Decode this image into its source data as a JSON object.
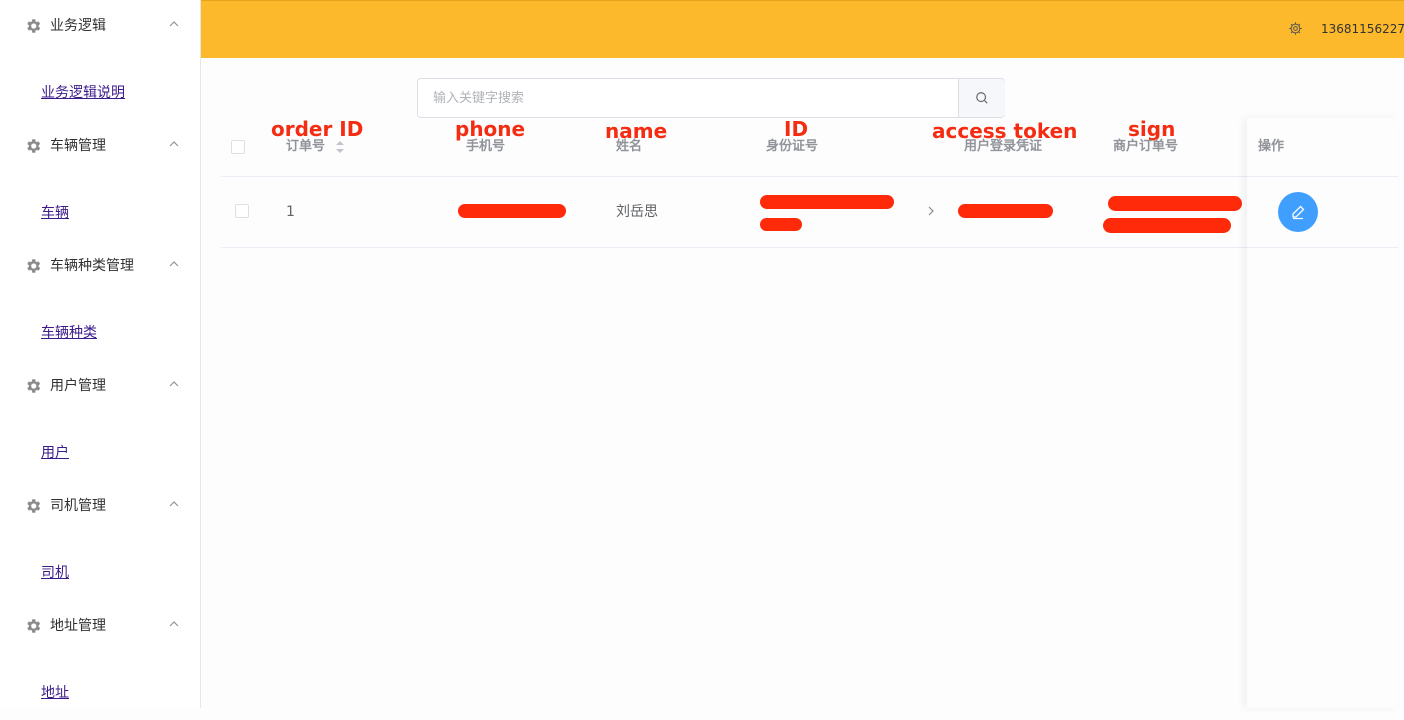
{
  "sidebar": {
    "groups": [
      {
        "title": "业务逻辑",
        "item": "业务逻辑说明"
      },
      {
        "title": "车辆管理",
        "item": "车辆"
      },
      {
        "title": "车辆种类管理",
        "item": "车辆种类"
      },
      {
        "title": "用户管理",
        "item": "用户"
      },
      {
        "title": "司机管理",
        "item": "司机"
      },
      {
        "title": "地址管理",
        "item": "地址"
      }
    ]
  },
  "header": {
    "user": "13681156227",
    "bg_color": "#fbb92b"
  },
  "search": {
    "placeholder": "输入关键字搜索"
  },
  "table": {
    "annotations": [
      "order ID",
      "phone",
      "name",
      "ID",
      "access token",
      "sign"
    ],
    "columns": [
      "订单号",
      "手机号",
      "姓名",
      "身份证号",
      "用户登录凭证",
      "商户订单号",
      "操作"
    ],
    "rows": [
      {
        "order_id": "1",
        "name": "刘岳思"
      }
    ]
  },
  "colors": {
    "accent": "#409eff",
    "annotation": "#f42d12"
  }
}
